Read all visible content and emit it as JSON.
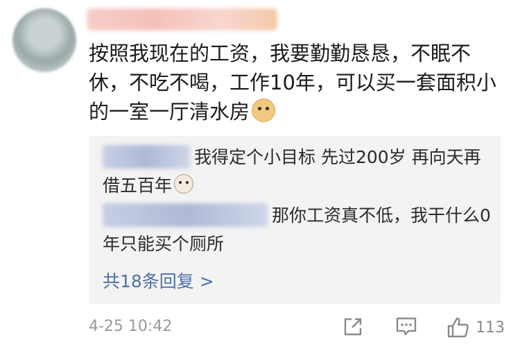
{
  "comment": {
    "text": "按照我现在的工资，我要勤勤恳恳，不眠不休，不吃不喝，工作10年，可以买一套面积小的一室一厅清水房",
    "emoji": "doge-emoji"
  },
  "replies": [
    {
      "text": "我得定个小目标  先过200岁  再向天再借五百年",
      "emoji": "cat-emoji"
    },
    {
      "text": "那你工资真不低，我干什么0年只能买个厕所"
    }
  ],
  "more_replies": "共18条回复 >",
  "footer": {
    "timestamp": "4-25 10:42",
    "like_count": "113"
  },
  "icons": [
    "share-icon",
    "comment-icon",
    "like-icon"
  ],
  "colors": {
    "link": "#4f6fa6",
    "meta": "#9a9a9a",
    "reply_bg": "#f3f3f3"
  }
}
